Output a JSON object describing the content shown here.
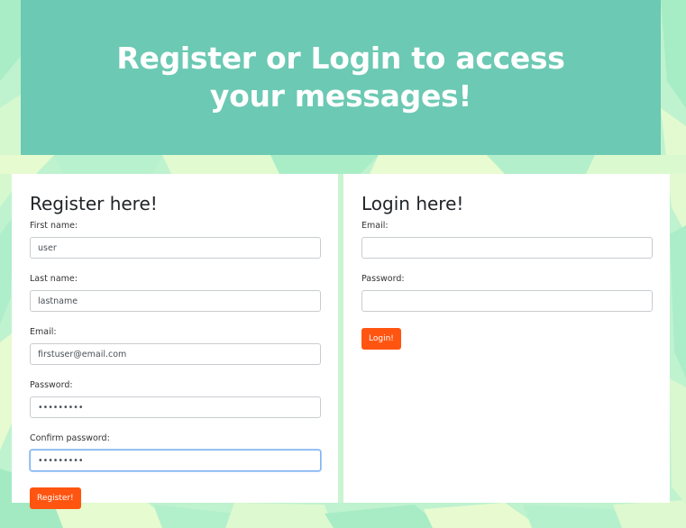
{
  "header": {
    "title": "Register or Login to access your messages!"
  },
  "register": {
    "heading": "Register here!",
    "first_name": {
      "label": "First name:",
      "value": "user"
    },
    "last_name": {
      "label": "Last name:",
      "value": "lastname"
    },
    "email": {
      "label": "Email:",
      "value": "firstuser@email.com"
    },
    "password": {
      "label": "Password:",
      "value": "•••••••••"
    },
    "confirm_password": {
      "label": "Confirm password:",
      "value": "•••••••••"
    },
    "submit_label": "Register!"
  },
  "login": {
    "heading": "Login here!",
    "email": {
      "label": "Email:",
      "value": ""
    },
    "password": {
      "label": "Password:",
      "value": ""
    },
    "submit_label": "Login!"
  },
  "colors": {
    "header_bg": "#6cc9b3",
    "button": "#ff5511",
    "background_green": "#bff2cf",
    "background_yellow": "#e6fbcf"
  }
}
